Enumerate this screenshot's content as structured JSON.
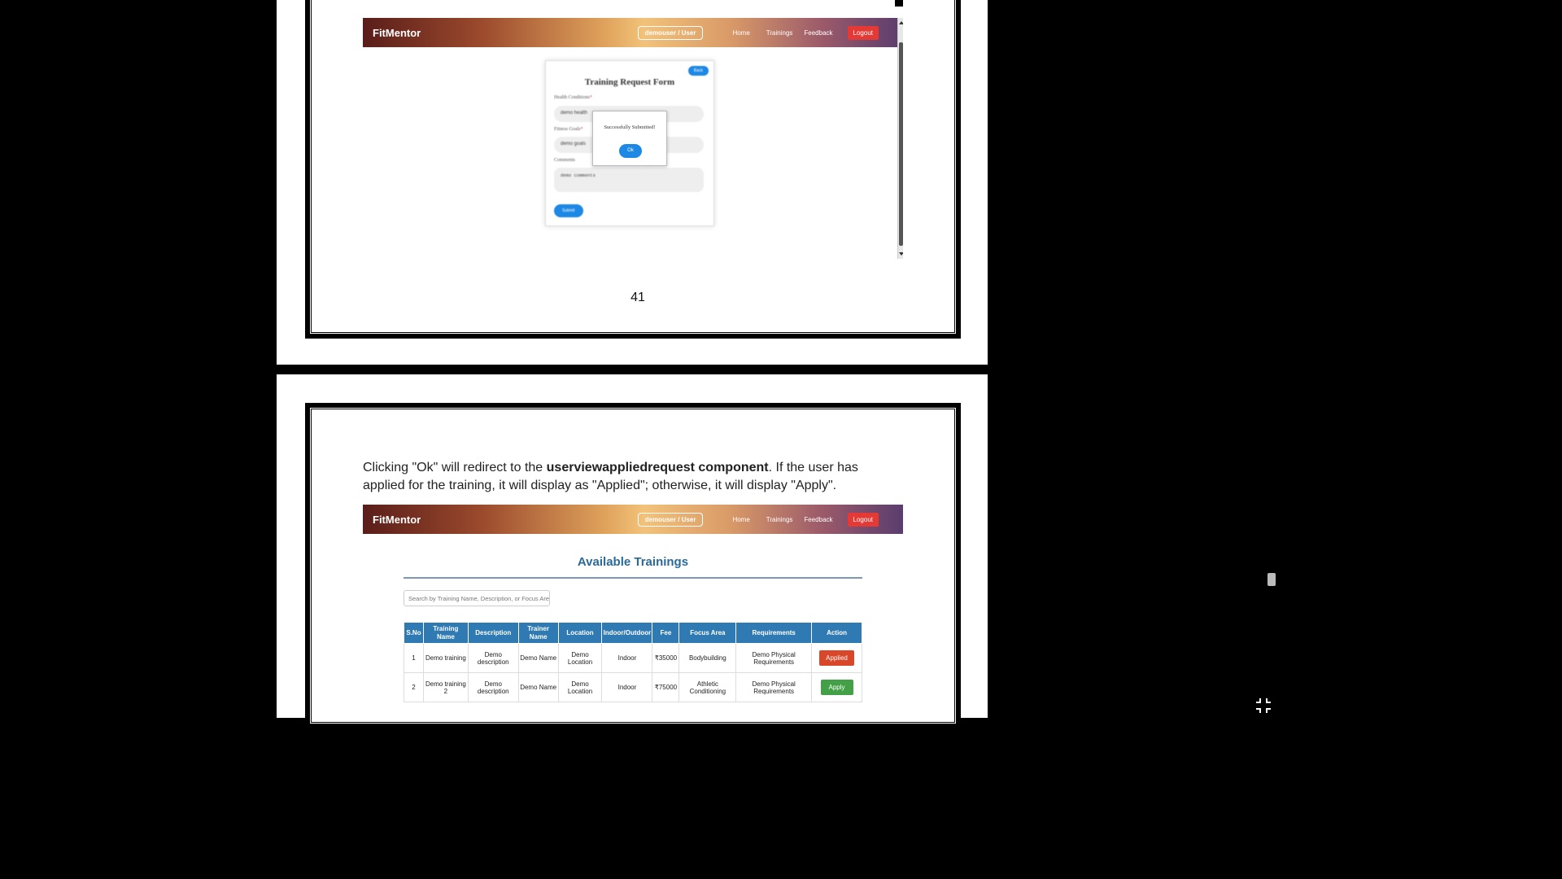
{
  "app": {
    "brand": "FitMentor",
    "user": "demouser / User",
    "nav": [
      "Home",
      "Trainings",
      "Feedback"
    ],
    "logout": "Logout"
  },
  "form": {
    "title": "Training Request Form",
    "back": "Back",
    "health_label": "Health Conditions",
    "health_value": "demo health",
    "goals_label": "Fitness Goals",
    "goals_value": "demo goals",
    "comments_label": "Comments",
    "comments_value": "demo comments",
    "submit": "Submit"
  },
  "dialog": {
    "message": "Successfully Submitted!",
    "ok": "Ok"
  },
  "page_number": "41",
  "paragraph": {
    "before": "Clicking \"Ok\" will redirect to the ",
    "bold": "userviewappliedrequest component",
    "after": ". If the user has applied for the training, it will display as \"Applied\"; otherwise, it will display \"Apply\"."
  },
  "trainings": {
    "title": "Available Trainings",
    "search_placeholder": "Search by Training Name, Description, or Focus Area",
    "headers": [
      "S.No",
      "Training Name",
      "Description",
      "Trainer Name",
      "Location",
      "Indoor/Outdoor",
      "Fee",
      "Focus Area",
      "Requirements",
      "Action"
    ],
    "rows": [
      [
        "1",
        "Demo training",
        "Demo description",
        "Demo Name",
        "Demo Location",
        "Indoor",
        "₹35000",
        "Bodybuilding",
        "Demo Physical Requirements",
        "Applied"
      ],
      [
        "2",
        "Demo training 2",
        "Demo description",
        "Demo Name",
        "Demo Location",
        "Indoor",
        "₹75000",
        "Athletic Conditioning",
        "Demo Physical Requirements",
        "Apply"
      ]
    ]
  },
  "icons": {
    "fullscreen": "exit-fullscreen-icon"
  }
}
